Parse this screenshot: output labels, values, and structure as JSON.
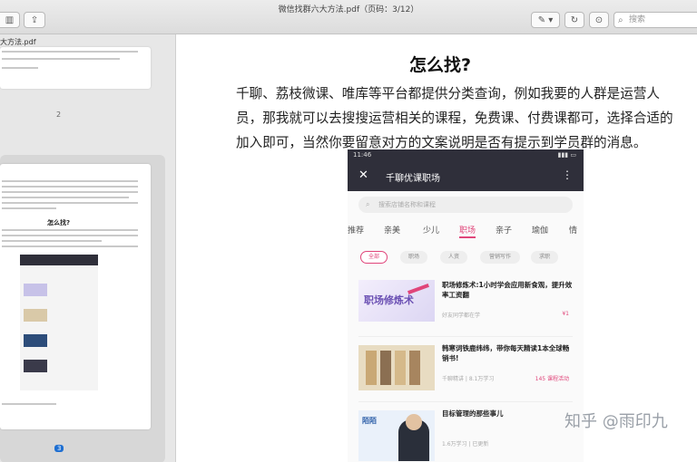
{
  "window": {
    "title": "微信找群六大方法.pdf（页码：3/12）"
  },
  "search": {
    "placeholder": "搜索"
  },
  "sidebar": {
    "file_label": "大方法.pdf",
    "page_selected_number": "3",
    "page_two_number": "2",
    "selected_thumb_heading": "怎么找?"
  },
  "main": {
    "heading": "怎么找?",
    "paragraph_lines": [
      "千聊、荔枝微课、唯库等平台都提供分类查询，例如我要的人群是运营人",
      "员，那我就可以去搜搜运营相关的课程，免费课、付费课都可，选择合适的",
      "加入即可，当然你要留意对方的文案说明是否有提示到学员群的消息。"
    ]
  },
  "phone": {
    "time": "11:46",
    "nav_title": "千聊优课职场",
    "search_placeholder": "搜索店铺名称和课程",
    "categories": [
      "推荐",
      "亲美",
      "少儿",
      "职场",
      "亲子",
      "瑜伽",
      "情"
    ],
    "active_category": "职场",
    "chips": [
      "全部",
      "职场",
      "人资",
      "营销写作",
      "求职"
    ],
    "courses": [
      {
        "thumb_text": "职场修炼术",
        "title": "职场修炼术:1小时学会应用新食观，提升效率工资翻",
        "meta": "好友同学都在学",
        "price": "¥1"
      },
      {
        "thumb_text": "",
        "title": "韩寒词铁鹿纬纬，带你每天精读1本全球畅销书!",
        "meta": "千聊精讲 | 8.1万学习",
        "price": "145 课程活动"
      },
      {
        "thumb_text": "陌陌",
        "title": "目标管理的那些事儿",
        "meta": "1.6万学习 | 已更新",
        "price": ""
      }
    ]
  },
  "watermark": "知乎 @雨印九"
}
